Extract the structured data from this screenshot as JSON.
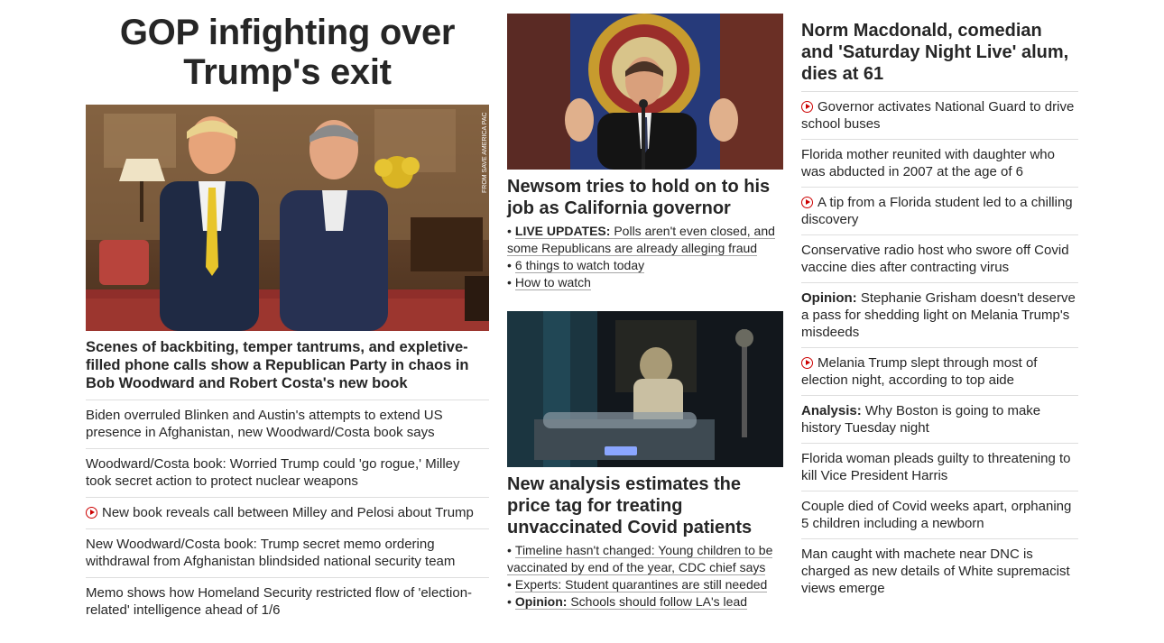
{
  "column1": {
    "headline": "GOP infighting over Trump's exit",
    "image_credit": "FROM SAVE AMERICA PAC",
    "subheadline": "Scenes of backbiting, temper tantrums, and expletive-filled phone calls show a Republican Party in chaos in Bob Woodward and Robert Costa's new book",
    "items": [
      {
        "text": "Biden overruled Blinken and Austin's attempts to extend US presence in Afghanistan, new Woodward/Costa book says",
        "video": false
      },
      {
        "text": "Woodward/Costa book: Worried Trump could 'go rogue,' Milley took secret action to protect nuclear weapons",
        "video": false
      },
      {
        "text": "New book reveals call between Milley and Pelosi about Trump",
        "video": true
      },
      {
        "text": "New Woodward/Costa book: Trump secret memo ordering withdrawal from Afghanistan blindsided national security team",
        "video": false
      },
      {
        "text": "Memo shows how Homeland Security restricted flow of 'election-related' intelligence ahead of 1/6",
        "video": false
      }
    ]
  },
  "column2": {
    "card1": {
      "headline": "Newsom tries to hold on to his job as California governor",
      "bullets": [
        {
          "label": "LIVE UPDATES:",
          "text": "Polls aren't even closed, and some Republicans are already alleging fraud"
        },
        {
          "label": "",
          "text": "6 things to watch today"
        },
        {
          "label": "",
          "text": "How to watch"
        }
      ]
    },
    "card2": {
      "headline": "New analysis estimates the price tag for treating unvaccinated Covid patients",
      "bullets": [
        {
          "label": "",
          "text": "Timeline hasn't changed: Young children to be vaccinated by end of the year, CDC chief says"
        },
        {
          "label": "",
          "text": "Experts: Student quarantines are still needed"
        },
        {
          "label": "Opinion:",
          "text": "Schools should follow LA's lead"
        }
      ]
    }
  },
  "column3": {
    "headline": "Norm Macdonald, comedian and 'Saturday Night Live' alum, dies at 61",
    "items": [
      {
        "label": "",
        "text": "Governor activates National Guard to drive school buses",
        "video": true
      },
      {
        "label": "",
        "text": "Florida mother reunited with daughter who was abducted in 2007 at the age of 6",
        "video": false
      },
      {
        "label": "",
        "text": "A tip from a Florida student led to a chilling discovery",
        "video": true
      },
      {
        "label": "",
        "text": "Conservative radio host who swore off Covid vaccine dies after contracting virus",
        "video": false
      },
      {
        "label": "Opinion:",
        "text": "Stephanie Grisham doesn't deserve a pass for shedding light on Melania Trump's misdeeds",
        "video": false
      },
      {
        "label": "",
        "text": "Melania Trump slept through most of election night, according to top aide",
        "video": true
      },
      {
        "label": "Analysis:",
        "text": "Why Boston is going to make history Tuesday night",
        "video": false
      },
      {
        "label": "",
        "text": "Florida woman pleads guilty to threatening to kill Vice President Harris",
        "video": false
      },
      {
        "label": "",
        "text": "Couple died of Covid weeks apart, orphaning 5 children including a newborn",
        "video": false
      },
      {
        "label": "",
        "text": "Man caught with machete near DNC is charged as new details of White supremacist views emerge",
        "video": false
      }
    ]
  },
  "colors": {
    "video_icon": "#cc0000",
    "divider": "#dedede",
    "text": "#262626"
  }
}
